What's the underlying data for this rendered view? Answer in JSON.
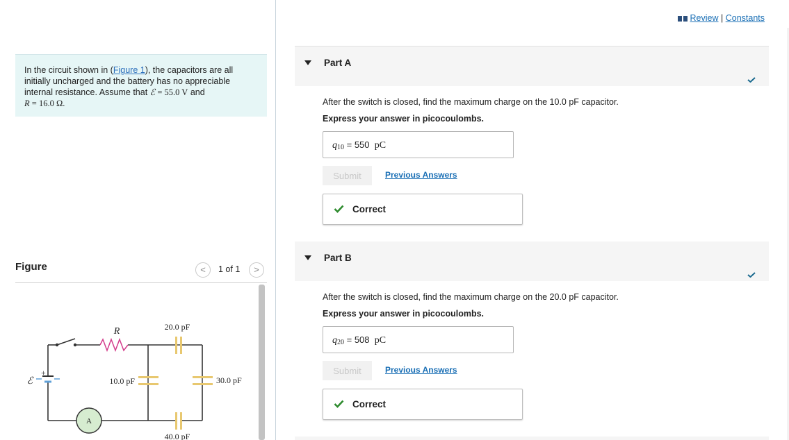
{
  "problem": {
    "intro_prefix": "In the circuit shown in (",
    "figure_link": "Figure 1",
    "intro_suffix": "), the capacitors are all initially uncharged and the battery has no appreciable internal resistance. Assume that ",
    "emf_symbol": "ℰ",
    "emf_value": " = 55.0 V",
    "and_text": " and",
    "r_symbol": "R",
    "r_value": " = 16.0 Ω."
  },
  "figure": {
    "title": "Figure",
    "pager_prev": "<",
    "pager_text": "1 of 1",
    "pager_next": ">"
  },
  "circuit": {
    "emf_label": "ℰ",
    "plus_sign": "+",
    "resistor_label": "R",
    "c20_label": "20.0 pF",
    "c10_label": "10.0 pF",
    "c30_label": "30.0 pF",
    "c40_label": "40.0 pF",
    "ammeter_label": "A"
  },
  "toplinks": {
    "review": "Review",
    "separator": " | ",
    "constants": "Constants"
  },
  "parts": [
    {
      "title": "Part A",
      "question": "After the switch is closed, find the maximum charge on the 10.0 pF capacitor.",
      "instruction": "Express your answer in picocoulombs.",
      "var": "q",
      "var_sub": "10",
      "eq": " = ",
      "value": "550",
      "unit": "pC",
      "submit": "Submit",
      "previous": "Previous Answers",
      "feedback": "Correct"
    },
    {
      "title": "Part B",
      "question": "After the switch is closed, find the maximum charge on the 20.0 pF capacitor.",
      "instruction": "Express your answer in picocoulombs.",
      "var": "q",
      "var_sub": "20",
      "eq": " = ",
      "value": "508",
      "unit": "pC",
      "submit": "Submit",
      "previous": "Previous Answers",
      "feedback": "Correct"
    }
  ],
  "colors": {
    "link": "#1a6fb5",
    "success": "#2e8b2e",
    "problem_bg": "#e6f6f6",
    "capacitor": "#e8c870",
    "ammeter_fill": "#d6ecd0"
  }
}
